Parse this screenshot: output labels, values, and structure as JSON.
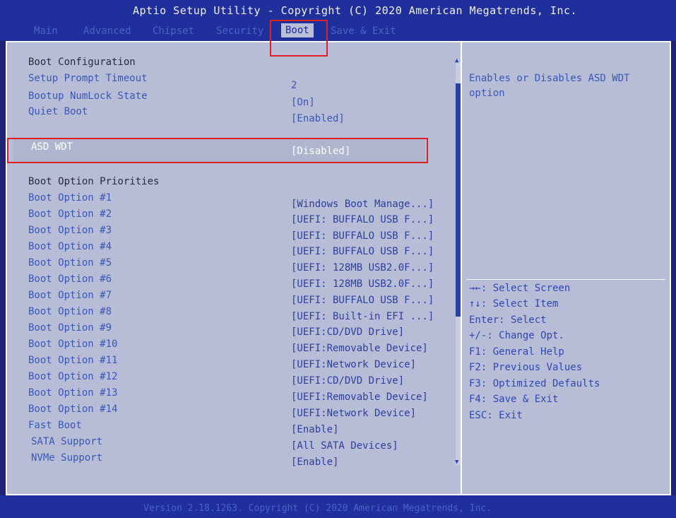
{
  "title": "Aptio Setup Utility - Copyright (C) 2020 American Megatrends, Inc.",
  "tabs": [
    {
      "label": "Main",
      "active": false
    },
    {
      "label": "Advanced",
      "active": false
    },
    {
      "label": "Chipset",
      "active": false
    },
    {
      "label": "Security",
      "active": false
    },
    {
      "label": "Boot",
      "active": true
    },
    {
      "label": "Save & Exit",
      "active": false
    }
  ],
  "settings": {
    "boot_configuration_heading": "Boot Configuration",
    "setup_prompt_timeout": {
      "label": "Setup Prompt Timeout",
      "value": "2"
    },
    "bootup_numlock_state": {
      "label": "Bootup NumLock State",
      "value": "[On]"
    },
    "quiet_boot": {
      "label": "Quiet Boot",
      "value": "[Enabled]"
    },
    "asd_wdt": {
      "label": "ASD WDT",
      "value": "[Disabled]"
    },
    "boot_option_priorities_heading": "Boot Option Priorities",
    "boot_options": [
      {
        "label": "Boot Option #1",
        "value": "[Windows Boot Manage...]"
      },
      {
        "label": "Boot Option #2",
        "value": "[UEFI: BUFFALO USB F...]"
      },
      {
        "label": "Boot Option #3",
        "value": "[UEFI: BUFFALO USB F...]"
      },
      {
        "label": "Boot Option #4",
        "value": "[UEFI: BUFFALO USB F...]"
      },
      {
        "label": "Boot Option #5",
        "value": "[UEFI: 128MB USB2.0F...]"
      },
      {
        "label": "Boot Option #6",
        "value": "[UEFI: 128MB USB2.0F...]"
      },
      {
        "label": "Boot Option #7",
        "value": "[UEFI: BUFFALO USB F...]"
      },
      {
        "label": "Boot Option #8",
        "value": "[UEFI: Built-in EFI ...]"
      },
      {
        "label": "Boot Option #9",
        "value": "[UEFI:CD/DVD Drive]"
      },
      {
        "label": "Boot Option #10",
        "value": "[UEFI:Removable Device]"
      },
      {
        "label": "Boot Option #11",
        "value": "[UEFI:Network Device]"
      },
      {
        "label": "Boot Option #12",
        "value": "[UEFI:CD/DVD Drive]"
      },
      {
        "label": "Boot Option #13",
        "value": "[UEFI:Removable Device]"
      },
      {
        "label": "Boot Option #14",
        "value": "[UEFI:Network Device]"
      }
    ],
    "fast_boot": {
      "label": "Fast Boot",
      "value": "[Enable]"
    },
    "sata_support": {
      "label": "SATA Support",
      "value": "[All SATA Devices]"
    },
    "nvme_support": {
      "label": "NVMe Support",
      "value": "[Enable]"
    }
  },
  "help": {
    "line1": "Enables or Disables ASD WDT",
    "line2": "option"
  },
  "keys": [
    "→←: Select Screen",
    "↑↓: Select Item",
    "Enter: Select",
    "+/-: Change Opt.",
    "F1: General Help",
    "F2: Previous Values",
    "F3: Optimized Defaults",
    "F4: Save & Exit",
    "ESC: Exit"
  ],
  "footer": "Version 2.18.1263. Copyright (C) 2020 American Megatrends, Inc.",
  "colors": {
    "highlight_box": "#e02020",
    "background": "#b7bdd6",
    "header": "#1f2f9c"
  }
}
